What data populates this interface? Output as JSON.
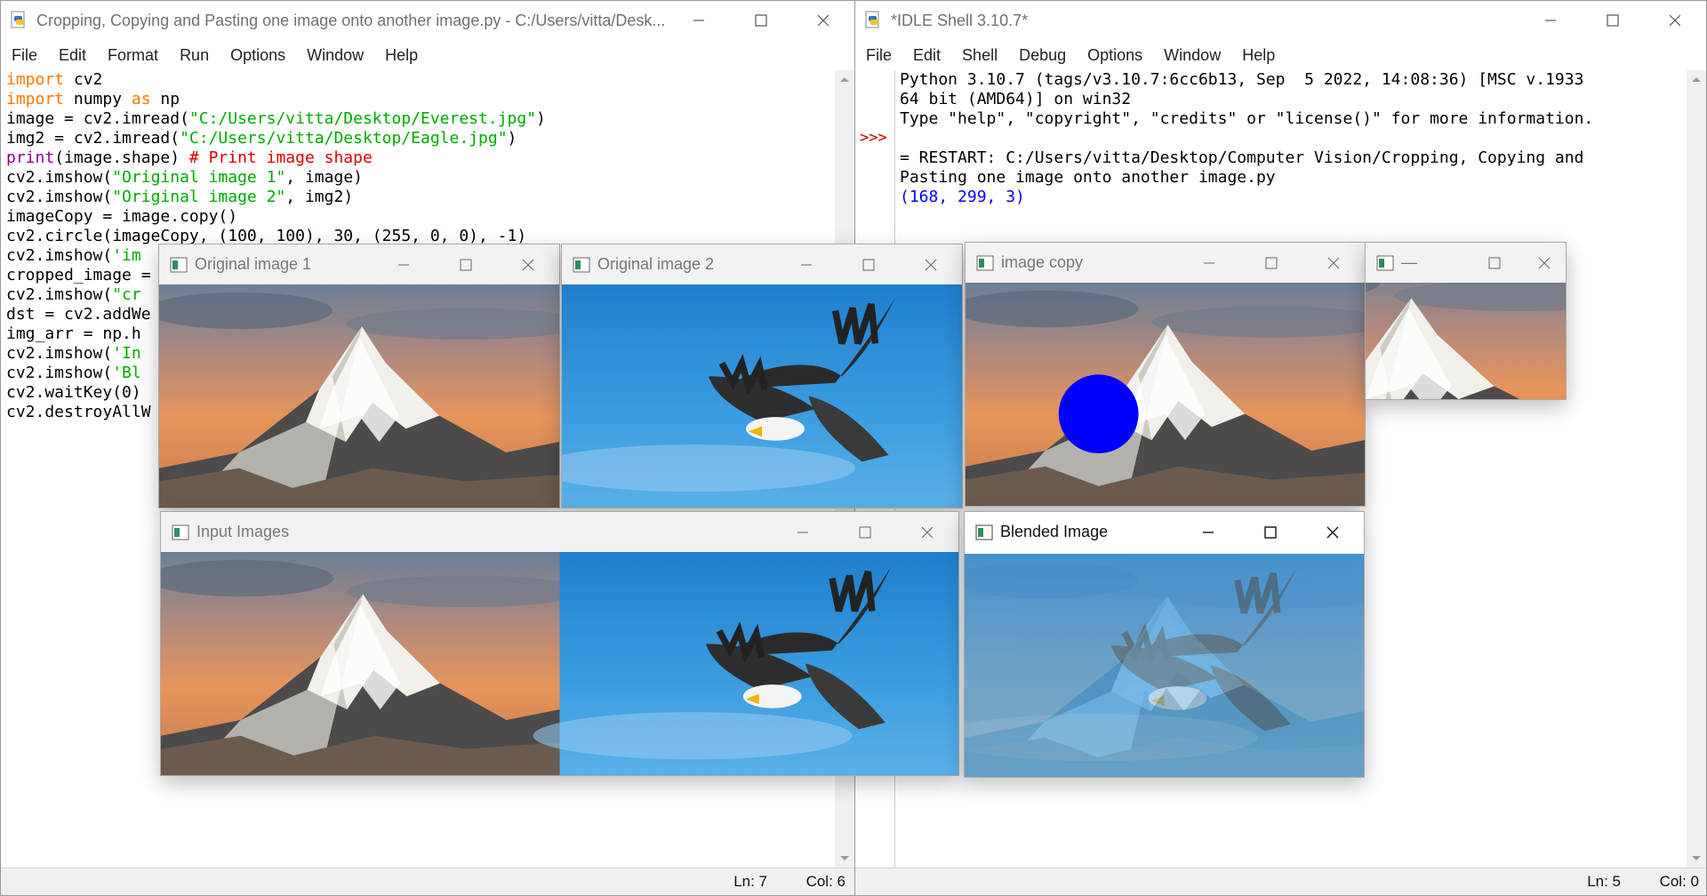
{
  "editor": {
    "title": "Cropping, Copying and Pasting one image onto another image.py - C:/Users/vitta/Desk...",
    "menu": [
      "File",
      "Edit",
      "Format",
      "Run",
      "Options",
      "Window",
      "Help"
    ],
    "code_lines": [
      [
        {
          "t": "import",
          "c": "kw"
        },
        {
          "t": " cv2",
          "c": ""
        }
      ],
      [
        {
          "t": "import",
          "c": "kw"
        },
        {
          "t": " numpy ",
          "c": ""
        },
        {
          "t": "as",
          "c": "kw"
        },
        {
          "t": " np",
          "c": ""
        }
      ],
      [
        {
          "t": "image = cv2.imread(",
          "c": ""
        },
        {
          "t": "\"C:/Users/vitta/Desktop/Everest.jpg\"",
          "c": "str"
        },
        {
          "t": ")",
          "c": ""
        }
      ],
      [
        {
          "t": "img2 = cv2.imread(",
          "c": ""
        },
        {
          "t": "\"C:/Users/vitta/Desktop/Eagle.jpg\"",
          "c": "str"
        },
        {
          "t": ")",
          "c": ""
        }
      ],
      [
        {
          "t": "print",
          "c": "bi"
        },
        {
          "t": "(image.shape) ",
          "c": ""
        },
        {
          "t": "# Print image shape",
          "c": "cm"
        }
      ],
      [
        {
          "t": "cv2.imshow(",
          "c": ""
        },
        {
          "t": "\"Original image 1\"",
          "c": "str"
        },
        {
          "t": ", image)",
          "c": ""
        }
      ],
      [
        {
          "t": "cv2.imshow(",
          "c": ""
        },
        {
          "t": "\"Original image 2\"",
          "c": "str"
        },
        {
          "t": ", img2)",
          "c": ""
        }
      ],
      [
        {
          "t": "imageCopy = image.copy()",
          "c": ""
        }
      ],
      [
        {
          "t": "cv2.circle(imageCopy, (100, 100), 30, (255, 0, 0), -1)",
          "c": ""
        }
      ],
      [
        {
          "t": "cv2.imshow(",
          "c": ""
        },
        {
          "t": "'im",
          "c": "str"
        }
      ],
      [
        {
          "t": "cropped_image =",
          "c": ""
        }
      ],
      [
        {
          "t": "cv2.imshow(",
          "c": ""
        },
        {
          "t": "\"cr",
          "c": "str"
        }
      ],
      [
        {
          "t": "dst = cv2.addWe",
          "c": ""
        }
      ],
      [
        {
          "t": "img_arr = np.h",
          "c": ""
        }
      ],
      [
        {
          "t": "cv2.imshow(",
          "c": ""
        },
        {
          "t": "'In",
          "c": "str"
        }
      ],
      [
        {
          "t": "cv2.imshow(",
          "c": ""
        },
        {
          "t": "'Bl",
          "c": "str"
        }
      ],
      [
        {
          "t": "cv2.waitKey(0)",
          "c": ""
        }
      ],
      [
        {
          "t": "cv2.destroyAllW",
          "c": ""
        }
      ]
    ],
    "status_ln": "Ln: 7",
    "status_col": "Col: 6"
  },
  "shell": {
    "title": "*IDLE Shell 3.10.7*",
    "menu": [
      "File",
      "Edit",
      "Shell",
      "Debug",
      "Options",
      "Window",
      "Help"
    ],
    "prompt": ">>>",
    "lines": [
      {
        "t": "Python 3.10.7 (tags/v3.10.7:6cc6b13, Sep  5 2022, 14:08:36) [MSC v.1933",
        "c": ""
      },
      {
        "t": "64 bit (AMD64)] on win32",
        "c": ""
      },
      {
        "t": "Type \"help\", \"copyright\", \"credits\" or \"license()\" for more information.",
        "c": ""
      },
      {
        "t": "",
        "c": ""
      },
      {
        "t": "= RESTART: C:/Users/vitta/Desktop/Computer Vision/Cropping, Copying and",
        "c": ""
      },
      {
        "t": "Pasting one image onto another image.py",
        "c": ""
      },
      {
        "t": "(168, 299, 3)",
        "c": "out"
      }
    ],
    "status_ln": "Ln: 5",
    "status_col": "Col: 0"
  },
  "cv_windows": {
    "original1": {
      "title": "Original image 1"
    },
    "original2": {
      "title": "Original image 2"
    },
    "copy": {
      "title": "image copy"
    },
    "cropped": {
      "title": "—"
    },
    "input": {
      "title": "Input Images"
    },
    "blended": {
      "title": "Blended Image"
    }
  },
  "colors": {
    "keyword": "#ff7700",
    "string": "#00aa00",
    "builtin": "#900090",
    "comment": "#dd0000",
    "output": "#0000ff",
    "prompt": "#c00000",
    "circle": "#0000ff",
    "sky_blue": "#2e8fd6"
  }
}
